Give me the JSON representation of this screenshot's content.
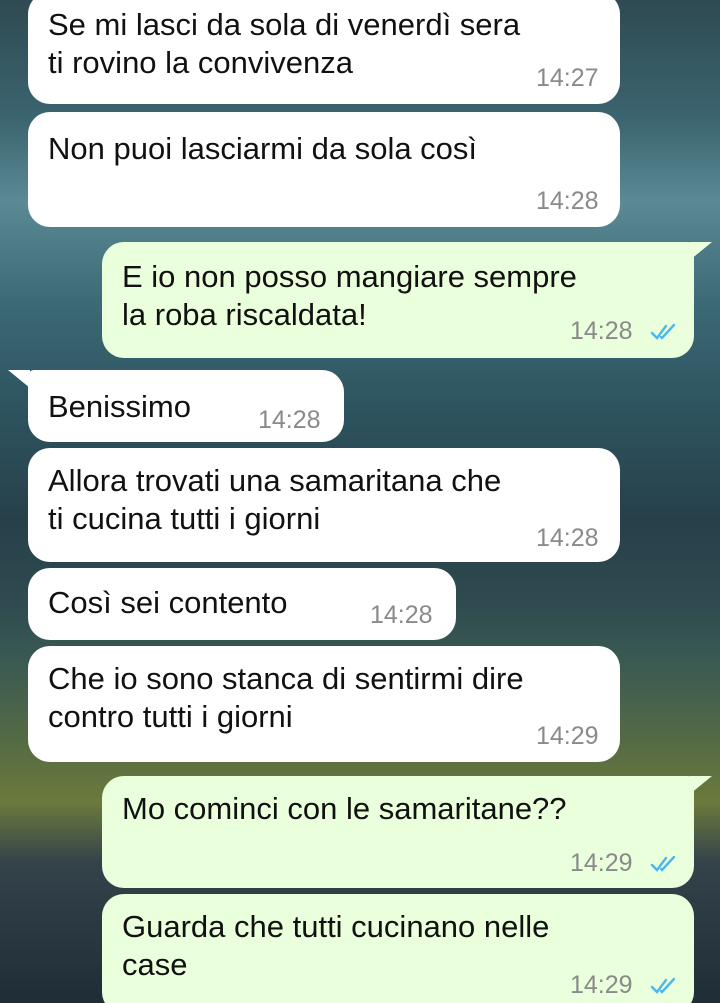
{
  "messages": [
    {
      "dir": "in",
      "text": "Se mi lasci da sola di venerdì sera\nti rovino la convivenza",
      "time": "14:27"
    },
    {
      "dir": "in",
      "text": "Non puoi lasciarmi da sola così",
      "time": "14:28"
    },
    {
      "dir": "out",
      "text": "E io non posso mangiare sempre\nla roba riscaldata!",
      "time": "14:28",
      "status": "read-ticks-icon"
    },
    {
      "dir": "in",
      "text": "Benissimo",
      "time": "14:28"
    },
    {
      "dir": "in",
      "text": "Allora trovati una samaritana che\nti cucina tutti i giorni",
      "time": "14:28"
    },
    {
      "dir": "in",
      "text": "Così sei contento",
      "time": "14:28"
    },
    {
      "dir": "in",
      "text": "Che io sono stanca di sentirmi dire\ncontro tutti i giorni",
      "time": "14:29"
    },
    {
      "dir": "out",
      "text": "Mo cominci con le samaritane??",
      "time": "14:29",
      "status": "read-ticks-icon"
    },
    {
      "dir": "out",
      "text": "Guarda che tutti cucinano nelle\ncase",
      "time": "14:29",
      "status": "read-ticks-icon"
    }
  ],
  "colors": {
    "incoming_bubble": "#ffffff",
    "outgoing_bubble": "#eaffdb",
    "timestamp": "#8a8a8a",
    "read_ticks": "#4fb6ec"
  }
}
